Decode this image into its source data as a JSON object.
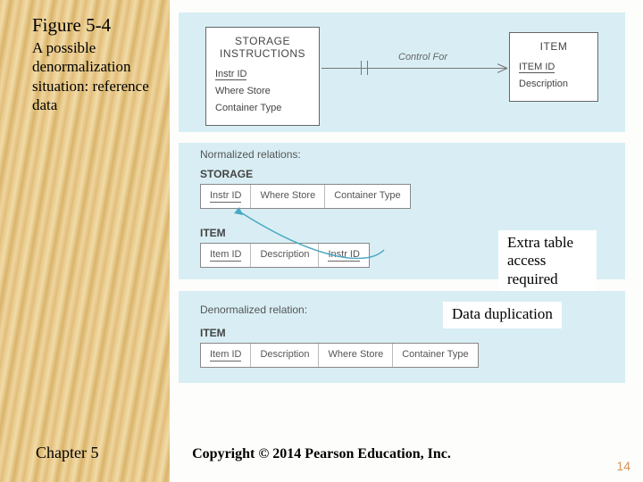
{
  "figure": {
    "number": "Figure 5-4",
    "caption": "A possible denormalization situation: reference data"
  },
  "erd": {
    "left_entity": {
      "title": "STORAGE INSTRUCTIONS",
      "pk": "Instr ID",
      "attrs": [
        "Where Store",
        "Container Type"
      ]
    },
    "right_entity": {
      "title": "ITEM",
      "pk": "ITEM ID",
      "attrs": [
        "Description"
      ]
    },
    "relationship": "Control For"
  },
  "normalized": {
    "heading": "Normalized relations:",
    "storage": {
      "title": "STORAGE",
      "cols": [
        "Instr ID",
        "Where Store",
        "Container Type"
      ]
    },
    "item": {
      "title": "ITEM",
      "cols": [
        "Item ID",
        "Description",
        "Instr ID"
      ]
    }
  },
  "denormalized": {
    "heading": "Denormalized relation:",
    "item": {
      "title": "ITEM",
      "cols": [
        "Item ID",
        "Description",
        "Where Store",
        "Container Type"
      ]
    }
  },
  "callouts": {
    "extra_access": "Extra table access required",
    "duplication": "Data duplication"
  },
  "footer": {
    "chapter": "Chapter 5",
    "copyright": "Copyright © 2014 Pearson Education, Inc.",
    "slide": "14"
  }
}
